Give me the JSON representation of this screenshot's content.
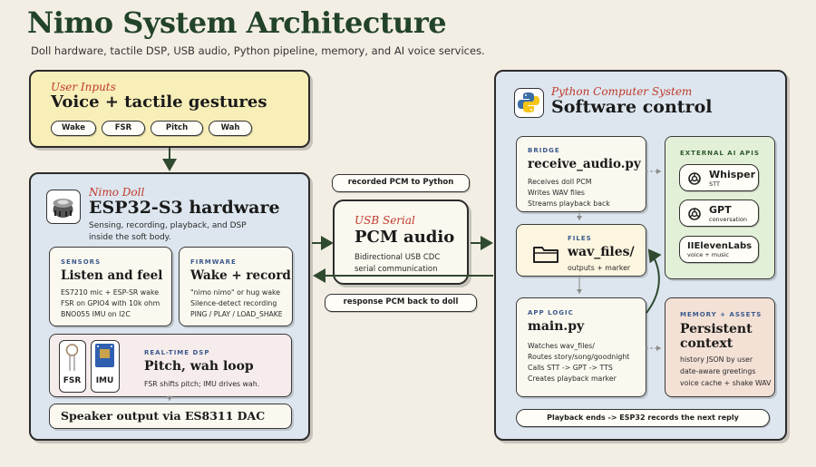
{
  "header": {
    "title": "Nimo System Architecture",
    "subtitle": "Doll hardware, tactile DSP, USB audio, Python pipeline, memory, and AI voice services."
  },
  "user_inputs": {
    "label": "User Inputs",
    "heading": "Voice + tactile gestures",
    "chips": [
      "Wake",
      "FSR",
      "Pitch",
      "Wah"
    ]
  },
  "doll": {
    "label": "Nimo Doll",
    "heading": "ESP32-S3 hardware",
    "desc": "Sensing, recording, playback, and DSP inside the soft body.",
    "sensors": {
      "tag": "SENSORS",
      "heading": "Listen and feel",
      "lines": [
        "ES7210 mic + ESP-SR wake",
        "FSR on GPIO4 with 10k ohm",
        "BNO055 IMU on I2C"
      ]
    },
    "firmware": {
      "tag": "FIRMWARE",
      "heading": "Wake + record",
      "lines": [
        "\"nimo nimo\" or hug wake",
        "Silence-detect recording",
        "PING / PLAY / LOAD_SHAKE"
      ]
    },
    "dsp": {
      "tag": "REAL-TIME DSP",
      "heading": "Pitch, wah loop",
      "desc": "FSR shifts pitch; IMU drives wah.",
      "fsr_label": "FSR",
      "imu_label": "IMU"
    },
    "speaker": "Speaker output via ES8311 DAC"
  },
  "usb": {
    "label": "USB Serial",
    "heading": "PCM audio",
    "lines": [
      "Bidirectional USB CDC",
      "serial communication"
    ],
    "top_pill": "recorded PCM to Python",
    "bottom_pill": "response PCM back to doll"
  },
  "python": {
    "label": "Python Computer System",
    "heading": "Software control",
    "bridge": {
      "tag": "BRIDGE",
      "heading": "receive_audio.py",
      "lines": [
        "Receives doll PCM",
        "Writes WAV files",
        "Streams playback back"
      ]
    },
    "files": {
      "tag": "FILES",
      "heading": "wav_files/",
      "desc": "outputs + marker"
    },
    "app": {
      "tag": "APP LOGIC",
      "heading": "main.py",
      "lines": [
        "Watches wav_files/",
        "Routes story/song/goodnight",
        "Calls STT -> GPT -> TTS",
        "Creates playback marker"
      ]
    },
    "apis": {
      "tag": "EXTERNAL AI APIS",
      "whisper": {
        "name": "Whisper",
        "sub": "STT"
      },
      "gpt": {
        "name": "GPT",
        "sub": "conversation"
      },
      "eleven": {
        "name": "IIElevenLabs",
        "sub": "voice + music"
      }
    },
    "memory": {
      "tag": "MEMORY + ASSETS",
      "heading": "Persistent context",
      "lines": [
        "history JSON by user",
        "date-aware greetings",
        "voice cache + shake WAV"
      ]
    },
    "footer_pill": "Playback ends -> ESP32 records the next reply"
  },
  "colors": {
    "title": "#22432a",
    "label_red": "#c0392b",
    "tag_blue": "#3a5a8c",
    "inputs_bg": "#f8eeb8",
    "doll_bg": "#dde6ee",
    "python_bg": "#dde6ee",
    "api_bg": "#e3f0d8",
    "memory_bg": "#f4e1d6",
    "dsp_bg": "#f7ecec"
  }
}
